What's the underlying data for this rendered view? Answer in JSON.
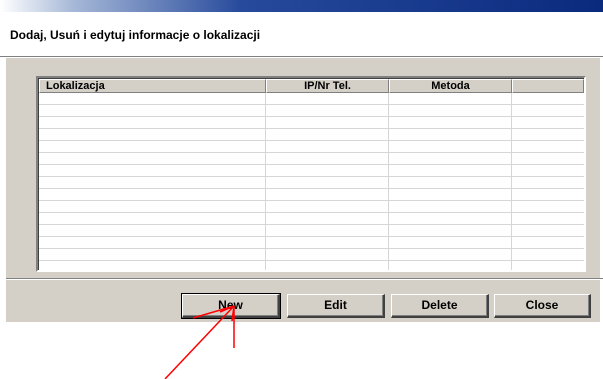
{
  "dialog": {
    "heading": "Dodaj, Usuń i edytuj informacje o lokalizacji"
  },
  "table": {
    "columns": [
      "Lokalizacja",
      "IP/Nr Tel.",
      "Metoda",
      ""
    ],
    "rows": []
  },
  "buttons": {
    "new_label": "New",
    "edit_label": "Edit",
    "delete_label": "Delete",
    "close_label": "Close"
  },
  "colors": {
    "titlebar": "#0a2a7e",
    "panel": "#d4d0c8",
    "arrow": "#ff0000"
  }
}
